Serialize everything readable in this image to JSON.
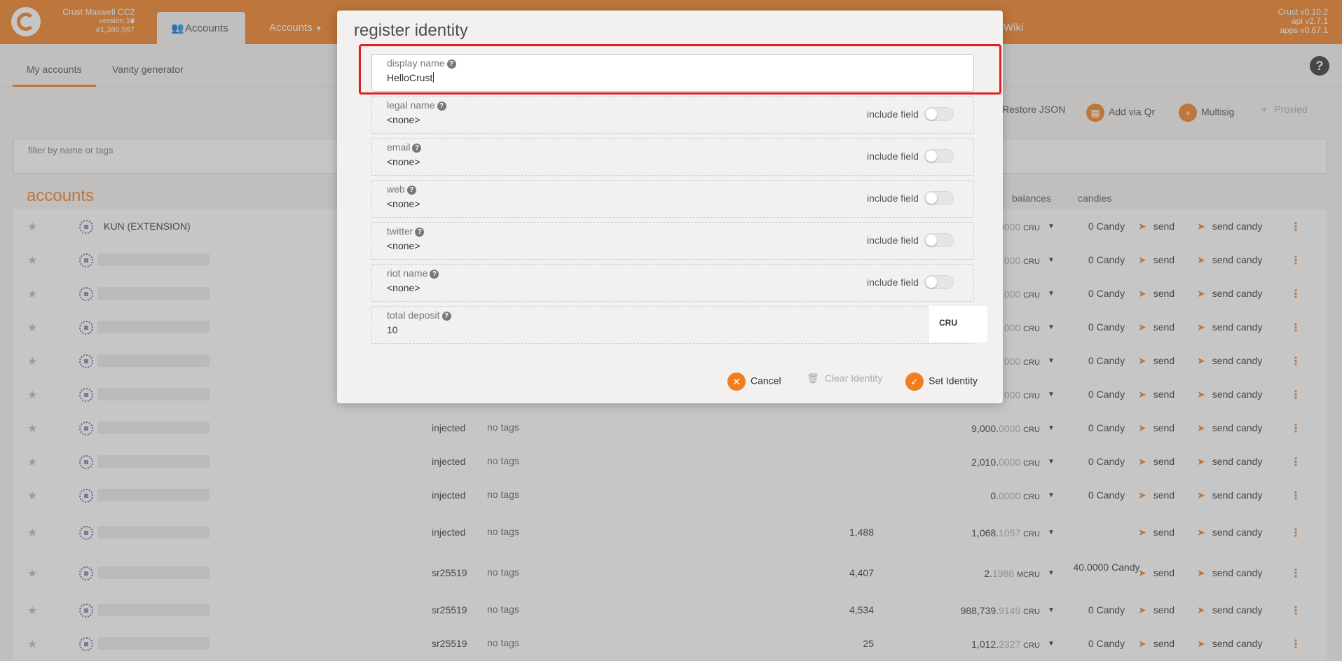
{
  "header": {
    "chain_name": "Crust Maxwell CC2",
    "chain_version": "version 10",
    "block": "#1,380,597",
    "nav": [
      {
        "label": "Accounts"
      },
      {
        "label": "Accounts"
      },
      {
        "label": "Wiki"
      }
    ],
    "versions": [
      "Crust v0.10.2",
      "api v2.7.1",
      "apps v0.67.1"
    ]
  },
  "subtabs": [
    "My accounts",
    "Vanity generator"
  ],
  "actions": {
    "restore_json": "Restore JSON",
    "add_via_qr": "Add via Qr",
    "multisig": "Multisig",
    "proxied": "Proxied"
  },
  "filter_placeholder": "filter by name or tags",
  "accounts_title": "accounts",
  "columns": {
    "balances": "balances",
    "candies": "candies"
  },
  "rows": [
    {
      "name": "KUN (EXTENSION)",
      "type": "",
      "tags": "",
      "num": "",
      "bal_int": "",
      "bal_dec": "0000",
      "unit": "CRU",
      "candy": "0 Candy"
    },
    {
      "name": "",
      "type": "",
      "tags": "",
      "num": "",
      "bal_int": "",
      "bal_dec": "000",
      "unit": "CRU",
      "candy": "0 Candy"
    },
    {
      "name": "",
      "type": "",
      "tags": "",
      "num": "",
      "bal_int": "",
      "bal_dec": "000",
      "unit": "CRU",
      "candy": "0 Candy"
    },
    {
      "name": "",
      "type": "",
      "tags": "",
      "num": "",
      "bal_int": "",
      "bal_dec": "000",
      "unit": "CRU",
      "candy": "0 Candy"
    },
    {
      "name": "",
      "type": "",
      "tags": "",
      "num": "",
      "bal_int": "",
      "bal_dec": "000",
      "unit": "CRU",
      "candy": "0 Candy"
    },
    {
      "name": "",
      "type": "",
      "tags": "",
      "num": "",
      "bal_int": "",
      "bal_dec": "000",
      "unit": "CRU",
      "candy": "0 Candy"
    },
    {
      "name": "",
      "type": "injected",
      "tags": "no tags",
      "num": "",
      "bal_int": "9,000.",
      "bal_dec": "0000",
      "unit": "CRU",
      "candy": "0 Candy"
    },
    {
      "name": "",
      "type": "injected",
      "tags": "no tags",
      "num": "",
      "bal_int": "2,010.",
      "bal_dec": "0000",
      "unit": "CRU",
      "candy": "0 Candy"
    },
    {
      "name": "",
      "type": "injected",
      "tags": "no tags",
      "num": "",
      "bal_int": "0.",
      "bal_dec": "0000",
      "unit": "CRU",
      "candy": "0 Candy"
    },
    {
      "name": "",
      "type": "injected",
      "tags": "no tags",
      "num": "1,488",
      "bal_int": "1,068.",
      "bal_dec": "1057",
      "unit": "CRU",
      "candy": ""
    },
    {
      "name": "",
      "type": "sr25519",
      "tags": "no tags",
      "num": "4,407",
      "bal_int": "2.",
      "bal_dec": "1988",
      "unit": "MCRU",
      "candy": "40.0000 Candy"
    },
    {
      "name": "",
      "type": "sr25519",
      "tags": "no tags",
      "num": "4,534",
      "bal_int": "988,739.",
      "bal_dec": "9149",
      "unit": "CRU",
      "candy": "0 Candy"
    },
    {
      "name": "",
      "type": "sr25519",
      "tags": "no tags",
      "num": "25",
      "bal_int": "1,012.",
      "bal_dec": "2327",
      "unit": "CRU",
      "candy": "0 Candy"
    }
  ],
  "row_actions": {
    "send": "send",
    "send_candy": "send candy"
  },
  "modal": {
    "title": "register identity",
    "fields": [
      {
        "label": "display name",
        "value": "HelloCrust"
      },
      {
        "label": "legal name",
        "value": "<none>",
        "include": "include field"
      },
      {
        "label": "email",
        "value": "<none>",
        "include": "include field"
      },
      {
        "label": "web",
        "value": "<none>",
        "include": "include field"
      },
      {
        "label": "twitter",
        "value": "<none>",
        "include": "include field"
      },
      {
        "label": "riot name",
        "value": "<none>",
        "include": "include field"
      }
    ],
    "deposit": {
      "label": "total deposit",
      "value": "10",
      "unit": "CRU"
    },
    "buttons": {
      "cancel": "Cancel",
      "clear": "Clear Identity",
      "set": "Set Identity"
    }
  },
  "colors": {
    "accent": "#f07e1f",
    "highlight": "#e02020"
  }
}
